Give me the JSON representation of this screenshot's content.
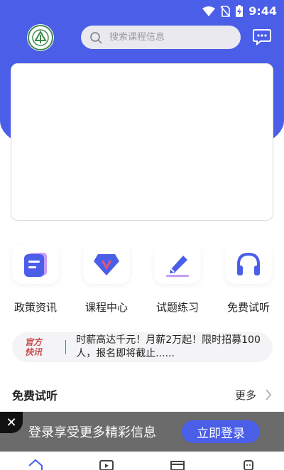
{
  "status_bar": {
    "time": "9:44"
  },
  "search": {
    "placeholder": "搜索课程信息"
  },
  "nav_items": [
    {
      "label": "政策资讯",
      "icon": "document-icon"
    },
    {
      "label": "课程中心",
      "icon": "v-diamond-icon"
    },
    {
      "label": "试题练习",
      "icon": "pen-icon"
    },
    {
      "label": "免费试听",
      "icon": "headphones-icon"
    }
  ],
  "notice": {
    "tag_line1": "官方",
    "tag_line2": "快讯",
    "text": "时薪高达千元！月薪2万起！限时招募100人，报名即将截止......"
  },
  "section": {
    "title": "免费试听",
    "more": "更多"
  },
  "login_bar": {
    "text": "登录享受更多精彩信息",
    "button": "立即登录",
    "close": "✕"
  },
  "colors": {
    "primary": "#4a5ee8",
    "notice_red": "#c94a4a"
  }
}
